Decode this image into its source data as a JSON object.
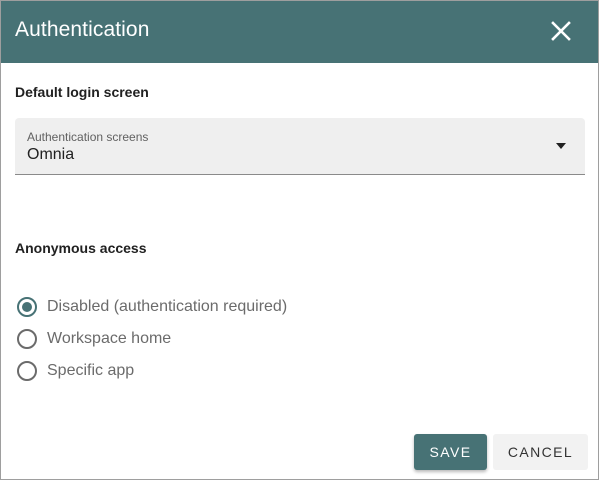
{
  "dialog": {
    "title": "Authentication",
    "close_icon": "close-icon"
  },
  "login": {
    "section_title": "Default login screen",
    "select_label": "Authentication screens",
    "select_value": "Omnia",
    "arrow_icon": "dropdown-arrow-icon"
  },
  "anonymous": {
    "section_title": "Anonymous access",
    "options": [
      {
        "label": "Disabled (authentication required)",
        "selected": true
      },
      {
        "label": "Workspace home",
        "selected": false
      },
      {
        "label": "Specific app",
        "selected": false
      }
    ]
  },
  "actions": {
    "save_label": "SAVE",
    "cancel_label": "CANCEL"
  },
  "colors": {
    "header_bg": "#477275",
    "accent": "#477275",
    "field_bg": "#efefef"
  }
}
